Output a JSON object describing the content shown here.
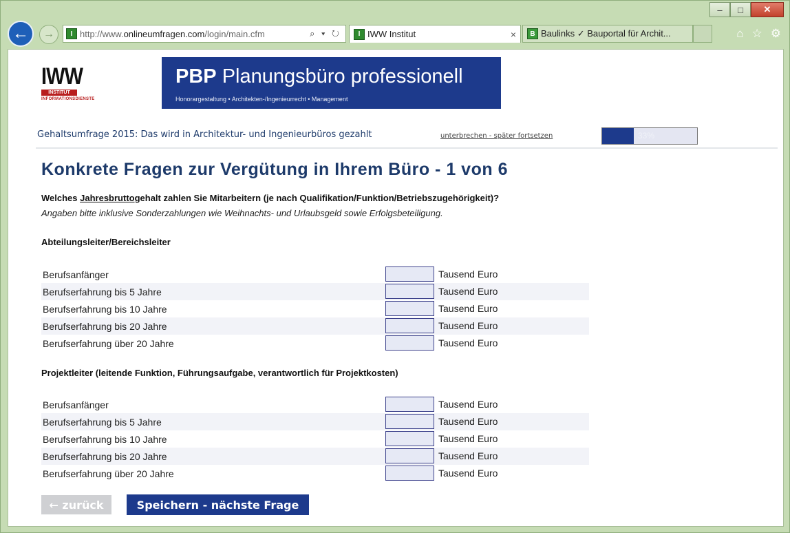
{
  "browser": {
    "address": {
      "prefix": "http://www.",
      "host": "onlineumfragen.com",
      "path": "/login/main.cfm",
      "tools": "⌕ ▾ ↻"
    },
    "tabs": [
      {
        "label": "IWW Institut",
        "close": "×",
        "active": true
      },
      {
        "label": "Baulinks ✓ Bauportal für Archit...",
        "active": false
      }
    ],
    "window_buttons": {
      "minimize": "–",
      "maximize": "□",
      "close": "✕"
    },
    "nav_icons": {
      "home": "⌂",
      "favorites": "☆",
      "settings": "⚙"
    },
    "favicon_letter": "I",
    "other_favicon_letter": "B"
  },
  "logo": {
    "big": "IWW",
    "bar": "INSTITUT",
    "sub": "INFORMATIONSDIENSTE"
  },
  "banner": {
    "title_bold": "PBP",
    "title_rest": " Planungsbüro professionell",
    "tagline": "Honorargestaltung • Architekten-/Ingenieurrecht • Management"
  },
  "survey": {
    "title": "Gehaltsumfrage 2015: Das wird in Architektur- und Ingenieurbüros gezahlt",
    "pause_link": "unterbrechen - später fortsetzen",
    "progress_percent": 33,
    "progress_label": "33%"
  },
  "heading": "Konkrete Fragen zur Vergütung in Ihrem Büro - 1 von 6",
  "question": {
    "before": "Welches ",
    "underlined": "Jahresbrutto",
    "after": "gehalt zahlen Sie Mitarbeitern (je nach Qualifikation/Funktion/Betriebszugehörigkeit)?",
    "hint": "Angaben bitte inklusive Sonderzahlungen wie Weihnachts- und Urlaubsgeld sowie Erfolgsbeteiligung."
  },
  "sections": [
    {
      "title": "Abteilungsleiter/Bereichsleiter",
      "unit": "Tausend Euro",
      "rows": [
        {
          "label": "Berufsanfänger",
          "value": ""
        },
        {
          "label": "Berufserfahrung bis 5 Jahre",
          "value": ""
        },
        {
          "label": "Berufserfahrung bis 10 Jahre",
          "value": ""
        },
        {
          "label": "Berufserfahrung bis 20 Jahre",
          "value": ""
        },
        {
          "label": "Berufserfahrung über 20 Jahre",
          "value": ""
        }
      ]
    },
    {
      "title": "Projektleiter (leitende Funktion, Führungsaufgabe, verantwortlich für Projektkosten)",
      "unit": "Tausend Euro",
      "rows": [
        {
          "label": "Berufsanfänger",
          "value": ""
        },
        {
          "label": "Berufserfahrung bis 5 Jahre",
          "value": ""
        },
        {
          "label": "Berufserfahrung bis 10 Jahre",
          "value": ""
        },
        {
          "label": "Berufserfahrung bis 20 Jahre",
          "value": ""
        },
        {
          "label": "Berufserfahrung über 20 Jahre",
          "value": ""
        }
      ]
    }
  ],
  "buttons": {
    "back": "← zurück",
    "next": "Speichern - nächste Frage"
  },
  "colors": {
    "brand": "#1d3a8c",
    "logo_red": "#b81e1e",
    "heading": "#1d3a6a"
  }
}
